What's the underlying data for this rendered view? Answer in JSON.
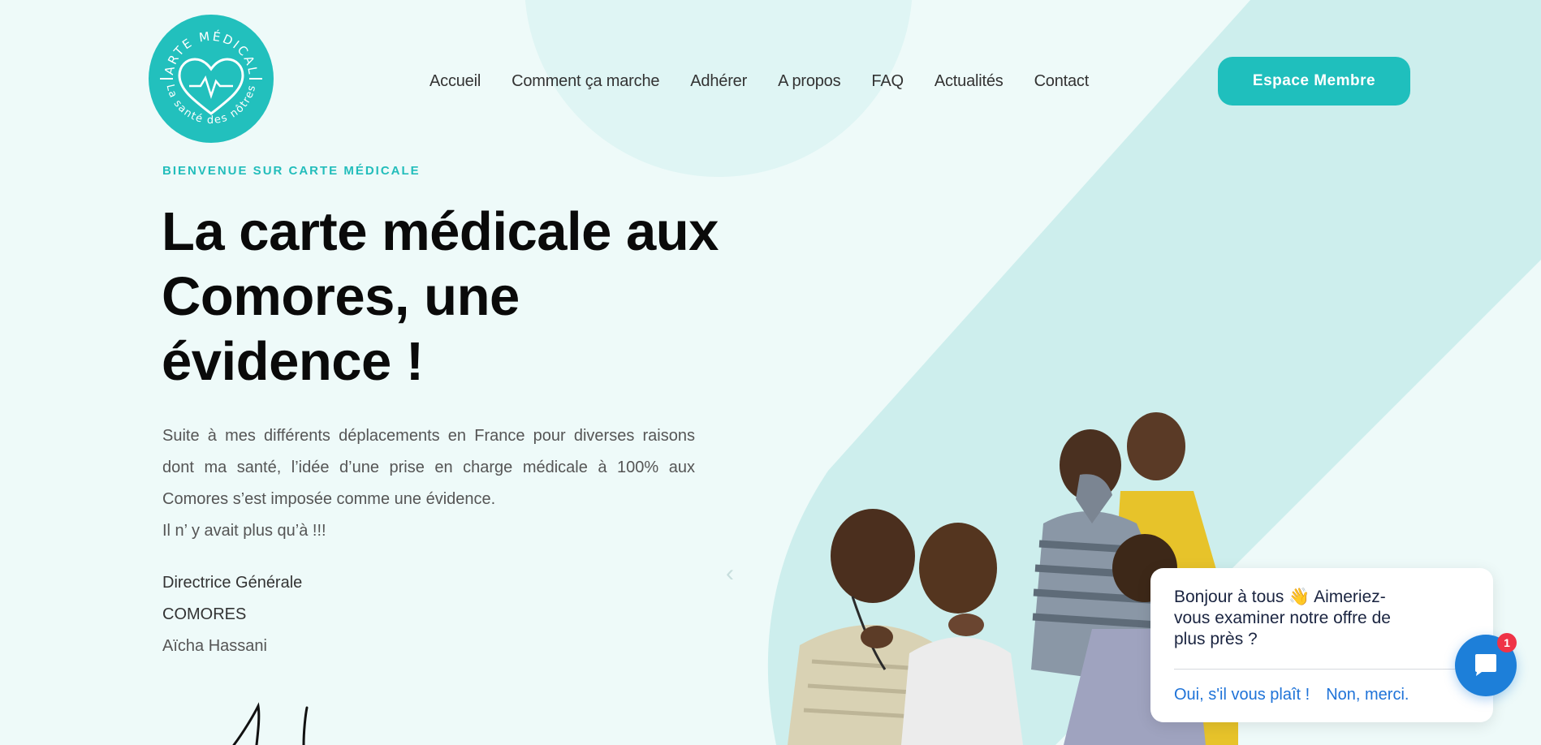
{
  "logo": {
    "top_text": "CARTE MÉDICALE",
    "bottom_text": "La santé des nôtres",
    "brand_color": "#22c0bd"
  },
  "nav": {
    "items": [
      "Accueil",
      "Comment ça marche",
      "Adhérer",
      "A propos",
      "FAQ",
      "Actualités",
      "Contact"
    ]
  },
  "header": {
    "member_button": "Espace Membre"
  },
  "hero": {
    "eyebrow": "BIENVENUE SUR CARTE MÉDICALE",
    "title_lines": [
      "La carte médicale aux",
      "Comores, une",
      "évidence !"
    ],
    "paragraph": "Suite à mes différents déplacements en France pour diverses raisons dont ma santé, l’idée d’une prise en charge médicale à 100% aux Comores s’est imposée comme une évidence.",
    "paragraph_end": "Il n’ y avait plus qu’à !!!",
    "signatory": {
      "role": "Directrice Générale",
      "country": "COMORES",
      "name": "Aïcha Hassani"
    }
  },
  "chat": {
    "message": "Bonjour à tous 👋 Aimeriez-vous examiner notre offre de plus près ?",
    "yes": "Oui, s'il vous plaît !",
    "no": "Non, merci.",
    "badge_count": "1",
    "accent_color": "#1d7fd9"
  },
  "colors": {
    "teal": "#1fbfbd",
    "band": "#cdeeed",
    "background": "#eefaf9"
  }
}
